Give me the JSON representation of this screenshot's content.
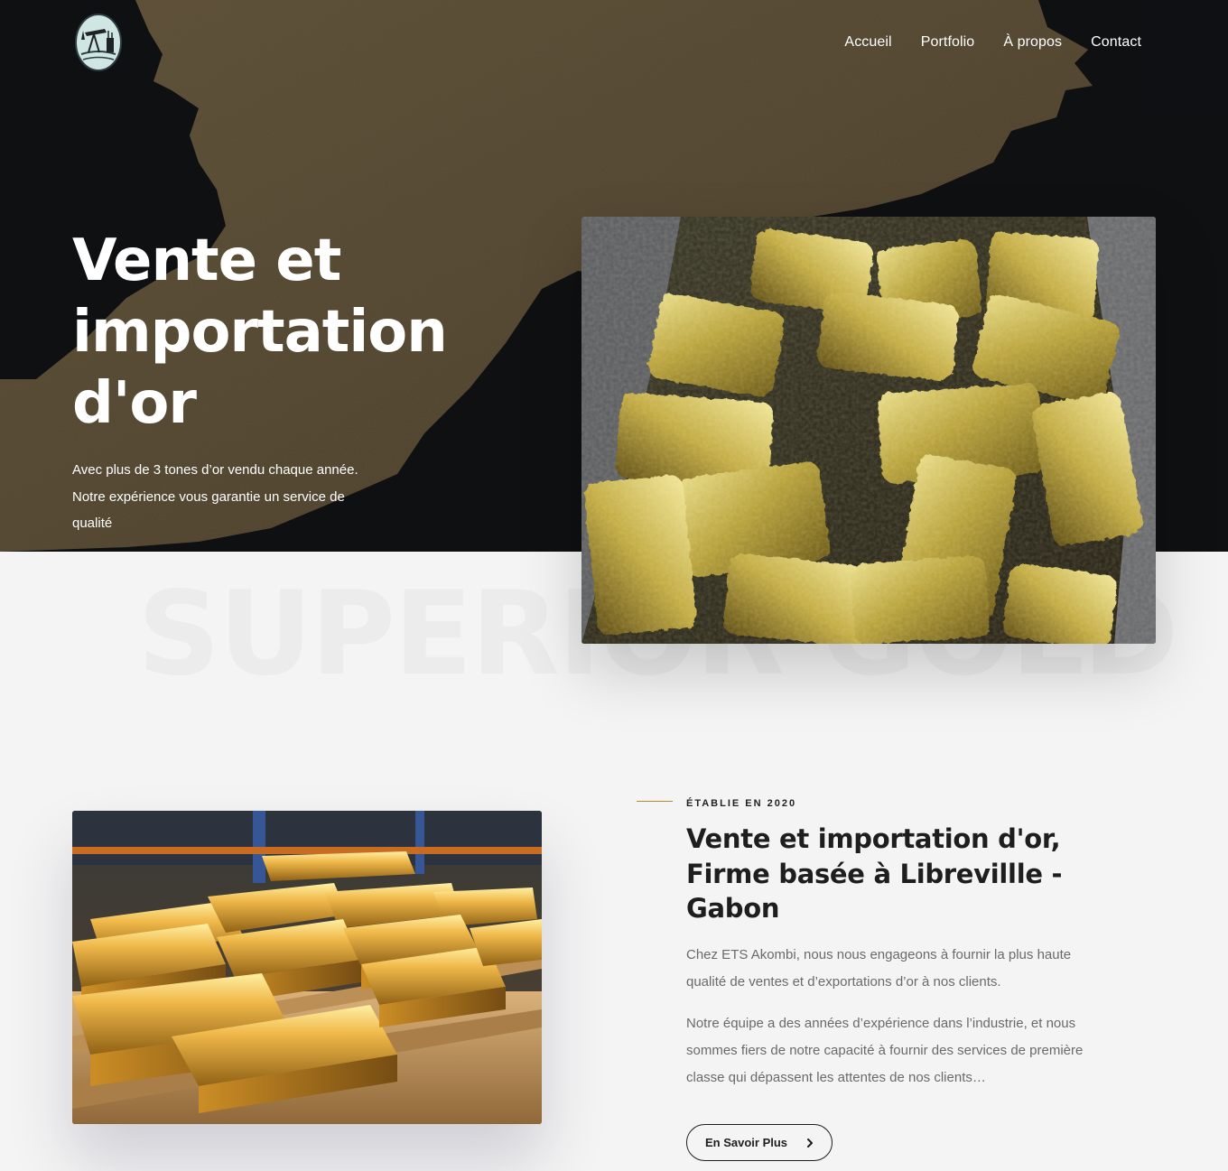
{
  "nav": {
    "items": [
      {
        "label": "Accueil"
      },
      {
        "label": "Portfolio"
      },
      {
        "label": "À propos"
      },
      {
        "label": "Contact"
      }
    ]
  },
  "hero": {
    "title_line1": "Vente et",
    "title_line2": "importation",
    "title_line3": "d'or",
    "subtitle_line1": "Avec plus de 3 tones d’or vendu chaque année.",
    "subtitle_line2": "Notre expérience vous garantie un service de",
    "subtitle_line3": "qualité",
    "watermark": "SUPERIOR GOLD"
  },
  "about": {
    "eyebrow": "ÉTABLIE EN 2020",
    "title_line1": "Vente et importation d'or,",
    "title_line2": "Firme basée à Librevillle -",
    "title_line3": "Gabon",
    "para1": "Chez ETS Akombi, nous nous engageons à fournir la plus haute qualité de ventes et d’exportations d’or à nos clients.",
    "para2": "Notre équipe a des années d’expérience dans l’industrie, et nous sommes fiers de notre capacité à fournir des services de première classe qui dépassent les attentes de nos clients…",
    "button_label": "En Savoir Plus"
  },
  "colors": {
    "hero_bg": "#121316",
    "brush": "#6b5a3c",
    "accent": "#b8892a",
    "text_dark": "#1e1e1e",
    "text_muted": "#6a6a6a",
    "page_bg": "#f4f4f4"
  },
  "icons": {
    "logo": "oil-pump-logo",
    "button": "chevron-right-icon"
  }
}
